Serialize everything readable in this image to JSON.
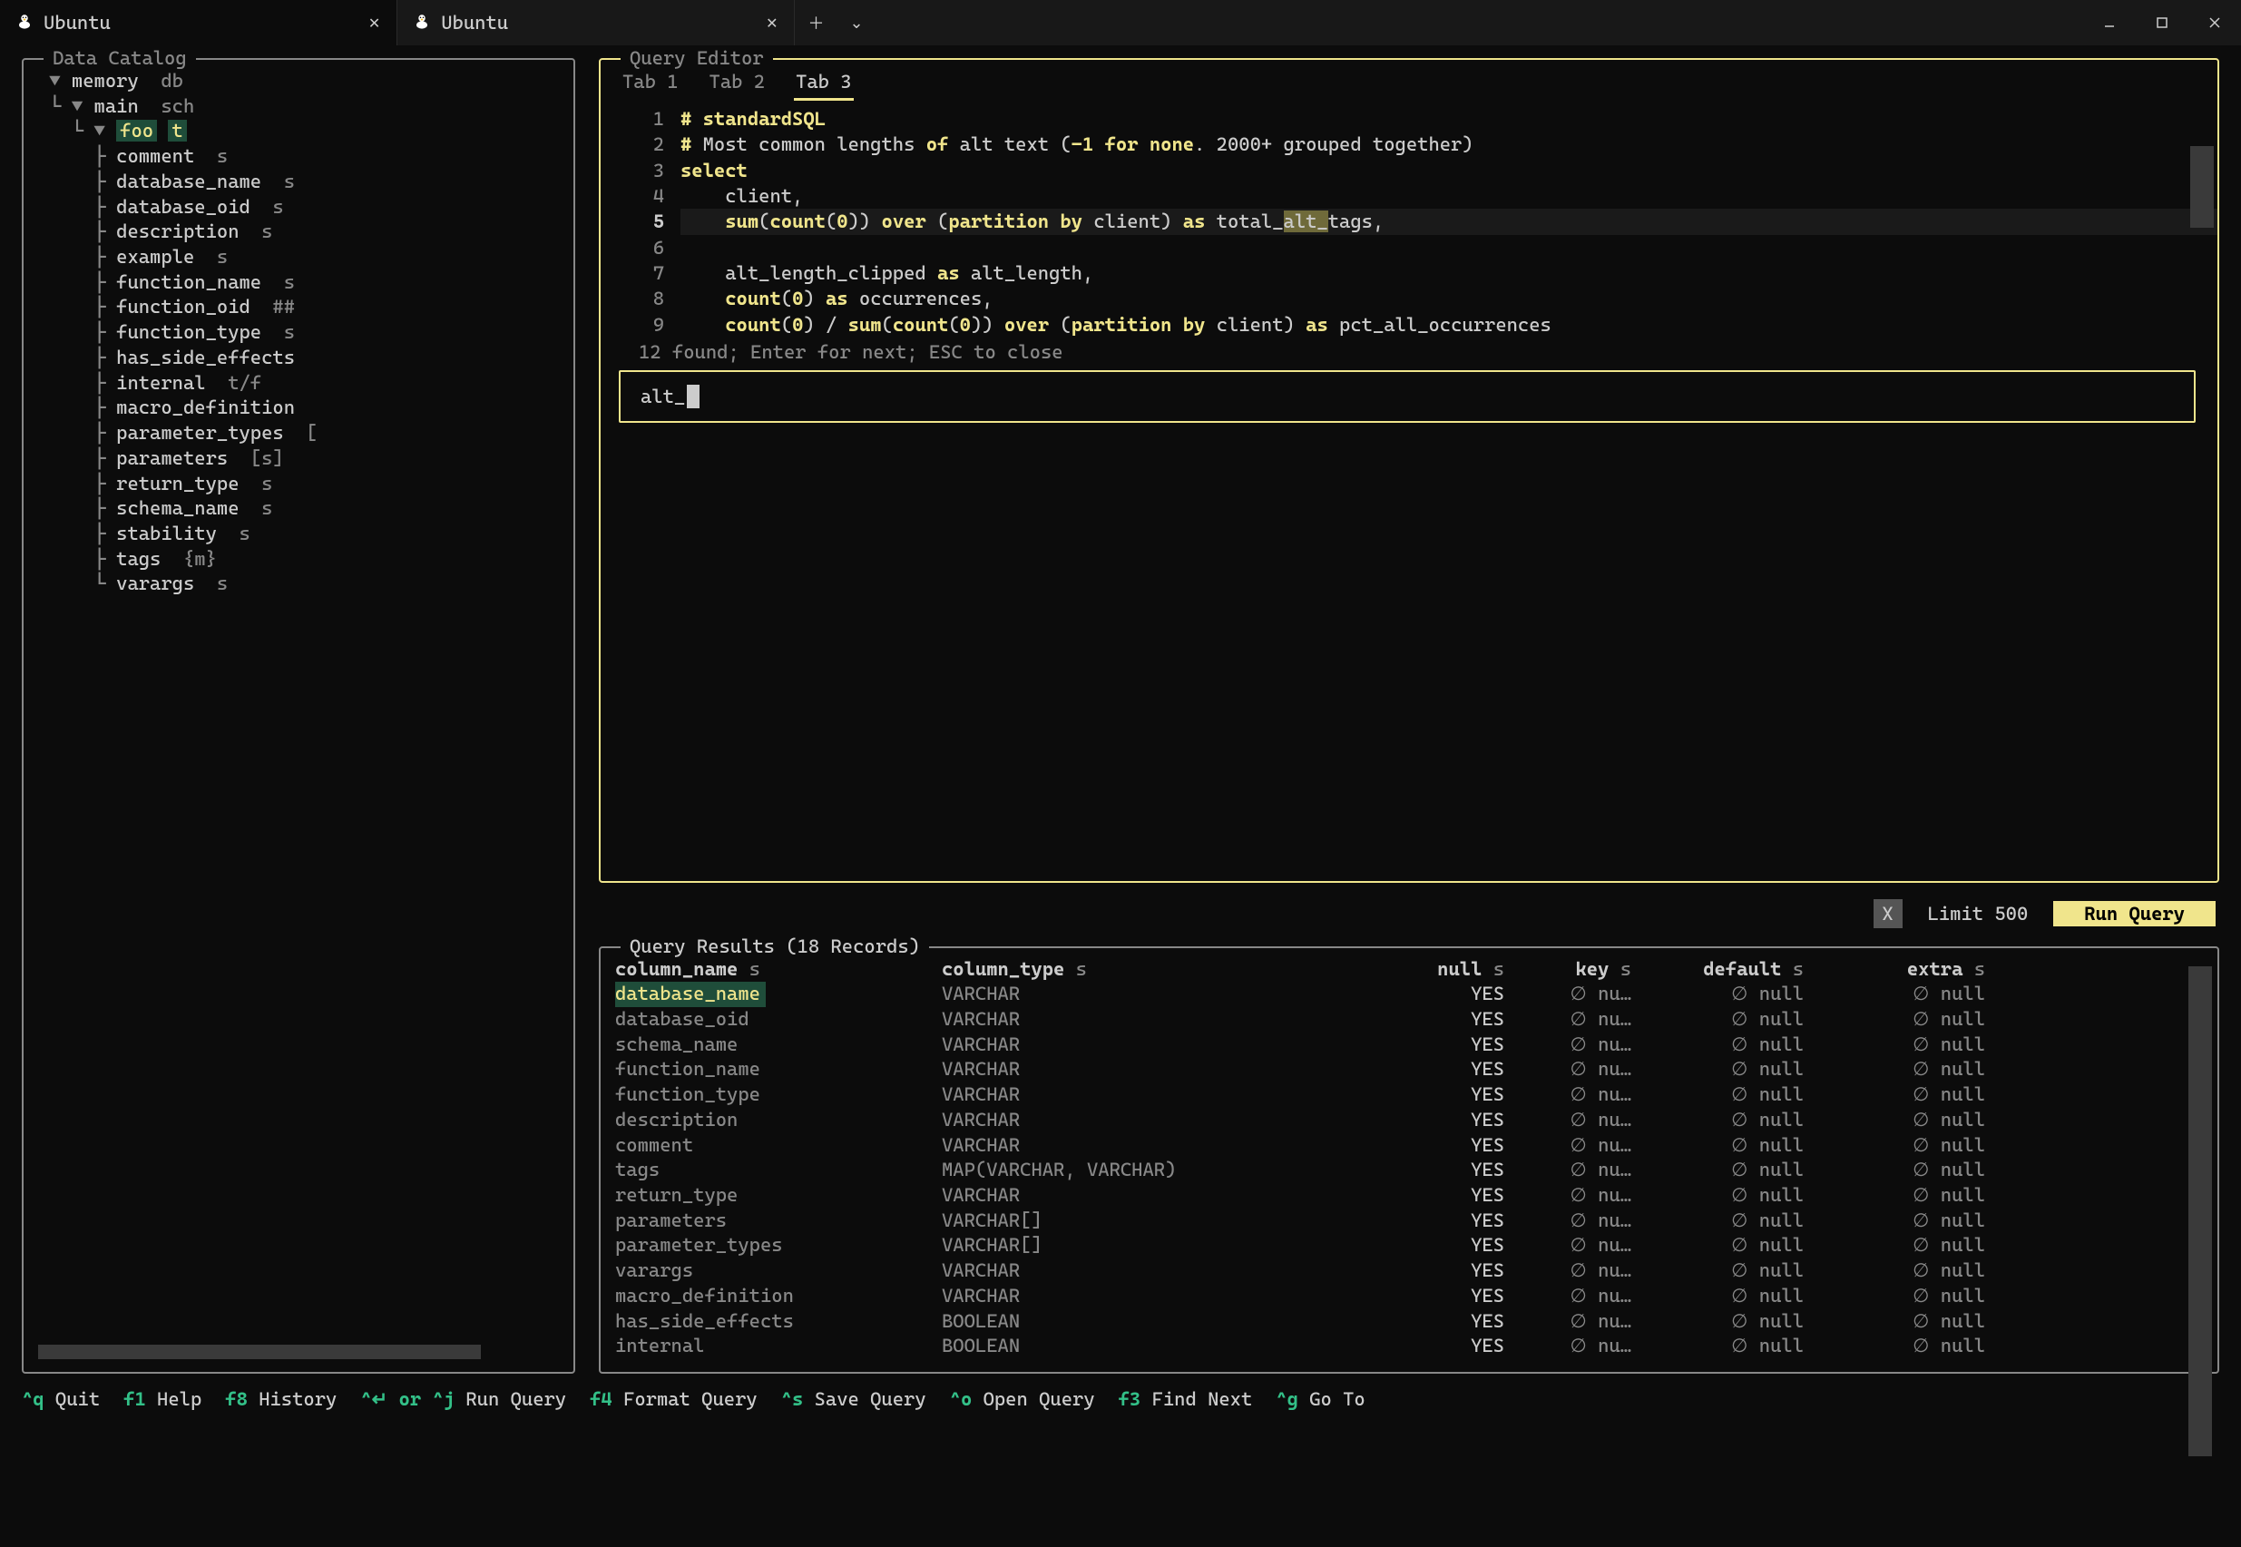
{
  "titlebar": {
    "tabs": [
      {
        "label": "Ubuntu",
        "active": true
      },
      {
        "label": "Ubuntu",
        "active": false
      }
    ]
  },
  "catalog": {
    "title": "Data Catalog",
    "root": {
      "name": "memory",
      "type": "db"
    },
    "schema": {
      "name": "main",
      "type": "sch"
    },
    "table": {
      "name": "foo",
      "type": "t"
    },
    "columns": [
      {
        "name": "comment",
        "type": "s"
      },
      {
        "name": "database_name",
        "type": "s"
      },
      {
        "name": "database_oid",
        "type": "s"
      },
      {
        "name": "description",
        "type": "s"
      },
      {
        "name": "example",
        "type": "s"
      },
      {
        "name": "function_name",
        "type": "s"
      },
      {
        "name": "function_oid",
        "type": "##"
      },
      {
        "name": "function_type",
        "type": "s"
      },
      {
        "name": "has_side_effects",
        "type": ""
      },
      {
        "name": "internal",
        "type": "t/f"
      },
      {
        "name": "macro_definition",
        "type": ""
      },
      {
        "name": "parameter_types",
        "type": "["
      },
      {
        "name": "parameters",
        "type": "[s]"
      },
      {
        "name": "return_type",
        "type": "s"
      },
      {
        "name": "schema_name",
        "type": "s"
      },
      {
        "name": "stability",
        "type": "s"
      },
      {
        "name": "tags",
        "type": "{m}"
      },
      {
        "name": "varargs",
        "type": "s"
      }
    ]
  },
  "editor": {
    "title": "Query Editor",
    "tabs": [
      "Tab 1",
      "Tab 2",
      "Tab 3"
    ],
    "active_tab": 2,
    "find_status": "12 found; Enter for next; ESC to close",
    "find_value": "alt_",
    "lines": [
      "1",
      "2",
      "3",
      "4",
      "5",
      "6",
      "7",
      "8",
      "9"
    ]
  },
  "runbar": {
    "x": "X",
    "limit_label": "Limit 500",
    "run_label": "Run Query"
  },
  "results": {
    "title": "Query Results (18 Records)",
    "headers": [
      {
        "name": "column_name",
        "type": "s"
      },
      {
        "name": "column_type",
        "type": "s"
      },
      {
        "name": "null",
        "type": "s"
      },
      {
        "name": "key",
        "type": "s"
      },
      {
        "name": "default",
        "type": "s"
      },
      {
        "name": "extra",
        "type": "s"
      }
    ],
    "rows": [
      {
        "c0": "database_name",
        "c1": "VARCHAR",
        "c2": "YES",
        "c3": "nu…",
        "c4": "null",
        "c5": "null",
        "sel": true
      },
      {
        "c0": "database_oid",
        "c1": "VARCHAR",
        "c2": "YES",
        "c3": "nu…",
        "c4": "null",
        "c5": "null"
      },
      {
        "c0": "schema_name",
        "c1": "VARCHAR",
        "c2": "YES",
        "c3": "nu…",
        "c4": "null",
        "c5": "null"
      },
      {
        "c0": "function_name",
        "c1": "VARCHAR",
        "c2": "YES",
        "c3": "nu…",
        "c4": "null",
        "c5": "null"
      },
      {
        "c0": "function_type",
        "c1": "VARCHAR",
        "c2": "YES",
        "c3": "nu…",
        "c4": "null",
        "c5": "null"
      },
      {
        "c0": "description",
        "c1": "VARCHAR",
        "c2": "YES",
        "c3": "nu…",
        "c4": "null",
        "c5": "null"
      },
      {
        "c0": "comment",
        "c1": "VARCHAR",
        "c2": "YES",
        "c3": "nu…",
        "c4": "null",
        "c5": "null"
      },
      {
        "c0": "tags",
        "c1": "MAP(VARCHAR, VARCHAR)",
        "c2": "YES",
        "c3": "nu…",
        "c4": "null",
        "c5": "null"
      },
      {
        "c0": "return_type",
        "c1": "VARCHAR",
        "c2": "YES",
        "c3": "nu…",
        "c4": "null",
        "c5": "null"
      },
      {
        "c0": "parameters",
        "c1": "VARCHAR[]",
        "c2": "YES",
        "c3": "nu…",
        "c4": "null",
        "c5": "null"
      },
      {
        "c0": "parameter_types",
        "c1": "VARCHAR[]",
        "c2": "YES",
        "c3": "nu…",
        "c4": "null",
        "c5": "null"
      },
      {
        "c0": "varargs",
        "c1": "VARCHAR",
        "c2": "YES",
        "c3": "nu…",
        "c4": "null",
        "c5": "null"
      },
      {
        "c0": "macro_definition",
        "c1": "VARCHAR",
        "c2": "YES",
        "c3": "nu…",
        "c4": "null",
        "c5": "null"
      },
      {
        "c0": "has_side_effects",
        "c1": "BOOLEAN",
        "c2": "YES",
        "c3": "nu…",
        "c4": "null",
        "c5": "null"
      },
      {
        "c0": "internal",
        "c1": "BOOLEAN",
        "c2": "YES",
        "c3": "nu…",
        "c4": "null",
        "c5": "null"
      }
    ]
  },
  "footer": [
    {
      "key": "^q",
      "label": "Quit"
    },
    {
      "key": "f1",
      "label": "Help"
    },
    {
      "key": "f8",
      "label": "History"
    },
    {
      "key": "^↵ or ^j",
      "label": "Run Query"
    },
    {
      "key": "f4",
      "label": "Format Query"
    },
    {
      "key": "^s",
      "label": "Save Query"
    },
    {
      "key": "^o",
      "label": "Open Query"
    },
    {
      "key": "f3",
      "label": "Find Next"
    },
    {
      "key": "^g",
      "label": "Go To"
    }
  ]
}
